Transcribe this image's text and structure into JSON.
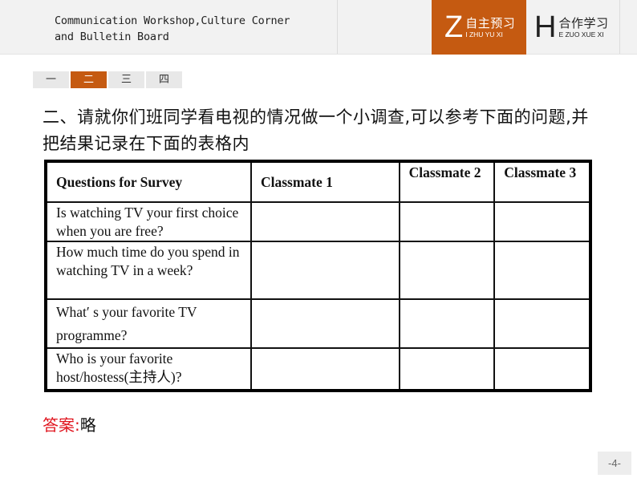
{
  "header": {
    "lesson_title_line1": "Communication Workshop,Culture Corner",
    "lesson_title_line2": "and Bulletin Board",
    "nav_tabs": [
      {
        "letter": "Z",
        "label": "自主预习",
        "pinyin": "I ZHU YU XI",
        "active": true
      },
      {
        "letter": "H",
        "label": "合作学习",
        "pinyin": "E ZUO XUE XI",
        "active": false
      }
    ],
    "accent_color": "#c55a11"
  },
  "section_tabs": [
    {
      "label": "一",
      "active": false
    },
    {
      "label": "二",
      "active": true
    },
    {
      "label": "三",
      "active": false
    },
    {
      "label": "四",
      "active": false
    }
  ],
  "question": "二、请就你们班同学看电视的情况做一个小调查,可以参考下面的问题,并把结果记录在下面的表格内",
  "table": {
    "headers": [
      "Questions for Survey",
      "Classmate 1",
      "Classmate 2",
      "Classmate 3"
    ],
    "rows": [
      [
        "Is watching TV your first choice when you are free?",
        "",
        "",
        ""
      ],
      [
        "How much time do you spend in watching TV in a week?",
        "",
        "",
        ""
      ],
      [
        "What′ s your favorite TV programme?",
        "",
        "",
        ""
      ],
      [
        "Who is your favorite host/hostess(主持人)?",
        "",
        "",
        ""
      ]
    ]
  },
  "answer": {
    "label": "答案:",
    "value": "略",
    "label_color": "#e0141e"
  },
  "page_number": "-4-"
}
